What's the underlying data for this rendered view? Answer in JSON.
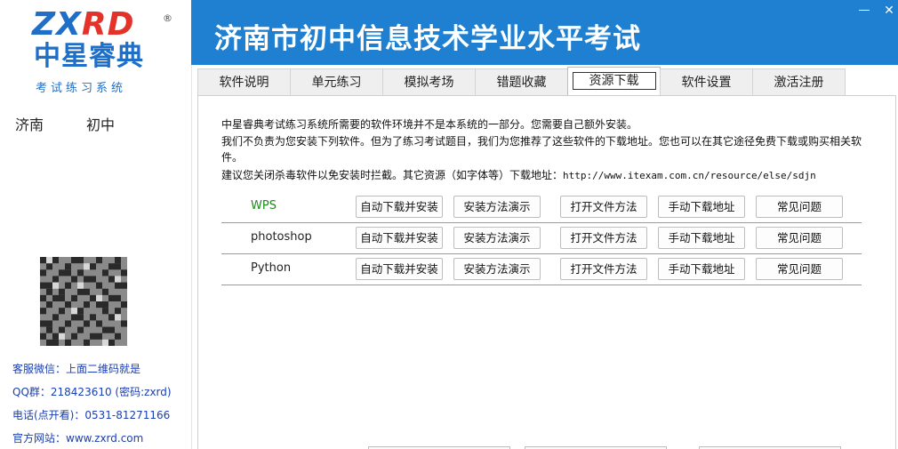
{
  "logo": {
    "en_main": "ZXRD",
    "en_part1": "ZX",
    "en_part2": "RD",
    "cn": "中星睿典",
    "sub": "考试练习系统",
    "reg": "®"
  },
  "title": "济南市初中信息技术学业水平考试",
  "window": {
    "minimize": "—",
    "close": "✕"
  },
  "tabs": [
    {
      "label": "软件说明",
      "active": false
    },
    {
      "label": "单元练习",
      "active": false
    },
    {
      "label": "模拟考场",
      "active": false
    },
    {
      "label": "错题收藏",
      "active": false
    },
    {
      "label": "资源下载",
      "active": true
    },
    {
      "label": "软件设置",
      "active": false
    },
    {
      "label": "激活注册",
      "active": false
    }
  ],
  "sidebar": {
    "city": "济南",
    "level": "初中",
    "contact": [
      "客服微信：上面二维码就是",
      "QQ群：218423610 (密码:zxrd)",
      "电话(点开看)：0531-81271166",
      "官方网站：www.zxrd.com"
    ]
  },
  "notes": {
    "line1": "中星睿典考试练习系统所需要的软件环境并不是本系统的一部分。您需要自己额外安装。",
    "line2": "我们不负责为您安装下列软件。但为了练习考试题目，我们为您推荐了这些软件的下载地址。您也可以在其它途径免费下载或购买相关软件。",
    "line3_prefix": "建议您关闭杀毒软件以免安装时拦截。其它资源（如字体等）下载地址：",
    "line3_url": "http://www.itexam.com.cn/resource/else/sdjn"
  },
  "software": [
    {
      "name": "WPS",
      "color": "#1a8a1a"
    },
    {
      "name": "photoshop",
      "color": "#222222"
    },
    {
      "name": "Python",
      "color": "#222222"
    }
  ],
  "actions": [
    "自动下载并安装",
    "安装方法演示",
    "打开文件方法",
    "手动下载地址",
    "常见问题"
  ],
  "colors": {
    "accent": "#1f7fd0",
    "brand_blue": "#1f6fc8",
    "brand_red": "#e4322b",
    "link": "#1a3fb0"
  }
}
